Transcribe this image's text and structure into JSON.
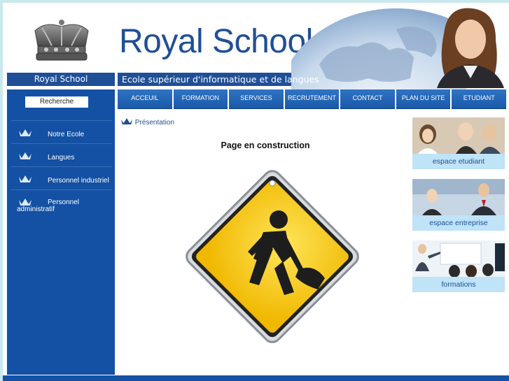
{
  "header": {
    "title": "Royal School",
    "bar_left": "Royal School",
    "bar_right": "Ecole supérieur d'informatique et de langues"
  },
  "sidebar": {
    "search_label": "Recherche",
    "items": [
      {
        "label": "Notre Ecole"
      },
      {
        "label": "Langues"
      },
      {
        "label": "Personnel industriel"
      },
      {
        "label": "Personnel administratif"
      }
    ]
  },
  "nav": {
    "items": [
      "ACCEUIL",
      "FORMATION",
      "SERVICES",
      "RECRUTEMENT",
      "CONTACT",
      "PLAN DU SITE",
      "ETUDIANT"
    ]
  },
  "main": {
    "breadcrumb": "Présentation",
    "title": "Page en construction"
  },
  "right": {
    "blocks": [
      {
        "caption": "espace etudiant"
      },
      {
        "caption": "espace entreprise"
      },
      {
        "caption": "formations"
      }
    ]
  },
  "colors": {
    "brand_blue": "#1450a3",
    "title_blue": "#1f4f97",
    "caption_bg": "#bfe3f7",
    "sign_yellow": "#f5c400"
  }
}
